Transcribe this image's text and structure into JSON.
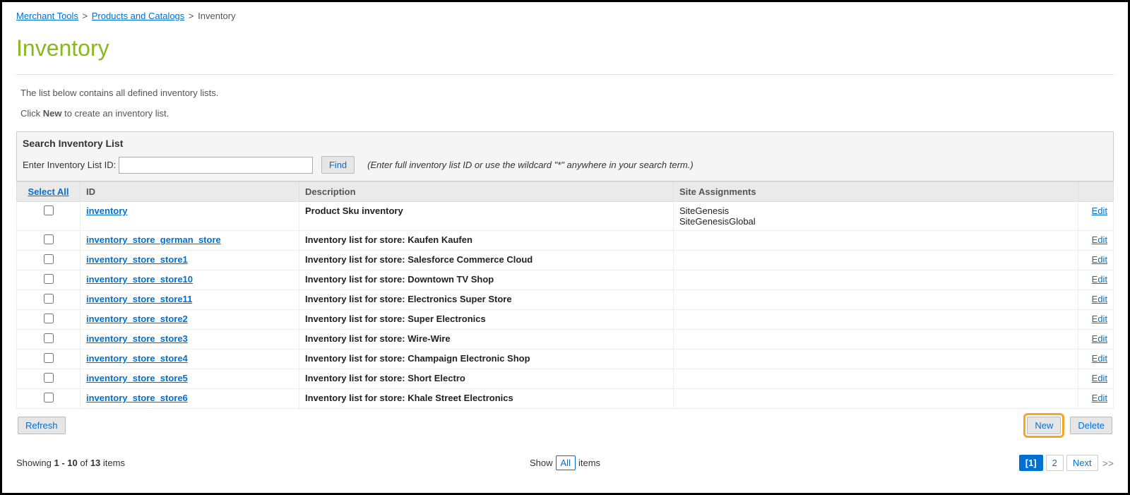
{
  "breadcrumb": {
    "link1": "Merchant Tools",
    "link2": "Products and Catalogs",
    "current": "Inventory"
  },
  "page_title": "Inventory",
  "intro": {
    "line1": "The list below contains all defined inventory lists.",
    "line2_prefix": "Click ",
    "line2_bold": "New",
    "line2_suffix": " to create an inventory list."
  },
  "search": {
    "title": "Search Inventory List",
    "label": "Enter Inventory List ID:",
    "find_btn": "Find",
    "hint": "(Enter full inventory list ID or use the wildcard \"*\" anywhere in your search term.)"
  },
  "columns": {
    "select_all": "Select All",
    "id": "ID",
    "description": "Description",
    "site": "Site Assignments"
  },
  "rows": [
    {
      "id": "inventory",
      "desc": "Product Sku inventory",
      "site": "SiteGenesis\nSiteGenesisGlobal",
      "edit": "Edit"
    },
    {
      "id": "inventory_store_german_store",
      "desc": "Inventory list for store: Kaufen Kaufen",
      "site": "",
      "edit": "Edit"
    },
    {
      "id": "inventory_store_store1",
      "desc": "Inventory list for store: Salesforce Commerce Cloud",
      "site": "",
      "edit": "Edit"
    },
    {
      "id": "inventory_store_store10",
      "desc": "Inventory list for store: Downtown TV Shop",
      "site": "",
      "edit": "Edit"
    },
    {
      "id": "inventory_store_store11",
      "desc": "Inventory list for store: Electronics Super Store",
      "site": "",
      "edit": "Edit"
    },
    {
      "id": "inventory_store_store2",
      "desc": "Inventory list for store: Super Electronics",
      "site": "",
      "edit": "Edit"
    },
    {
      "id": "inventory_store_store3",
      "desc": "Inventory list for store: Wire-Wire",
      "site": "",
      "edit": "Edit"
    },
    {
      "id": "inventory_store_store4",
      "desc": "Inventory list for store: Champaign Electronic Shop",
      "site": "",
      "edit": "Edit"
    },
    {
      "id": "inventory_store_store5",
      "desc": "Inventory list for store: Short Electro",
      "site": "",
      "edit": "Edit"
    },
    {
      "id": "inventory_store_store6",
      "desc": "Inventory list for store: Khale Street Electronics",
      "site": "",
      "edit": "Edit"
    }
  ],
  "actions": {
    "refresh": "Refresh",
    "new": "New",
    "delete": "Delete"
  },
  "footer": {
    "showing_prefix": "Showing ",
    "range": "1 - 10",
    "of_text": " of ",
    "total": "13",
    "items_text": " items",
    "show_label": "Show",
    "all_label": "All",
    "items_label": "items"
  },
  "pagination": {
    "page1": "[1]",
    "page2": "2",
    "next": "Next",
    "dbl": ">>"
  }
}
